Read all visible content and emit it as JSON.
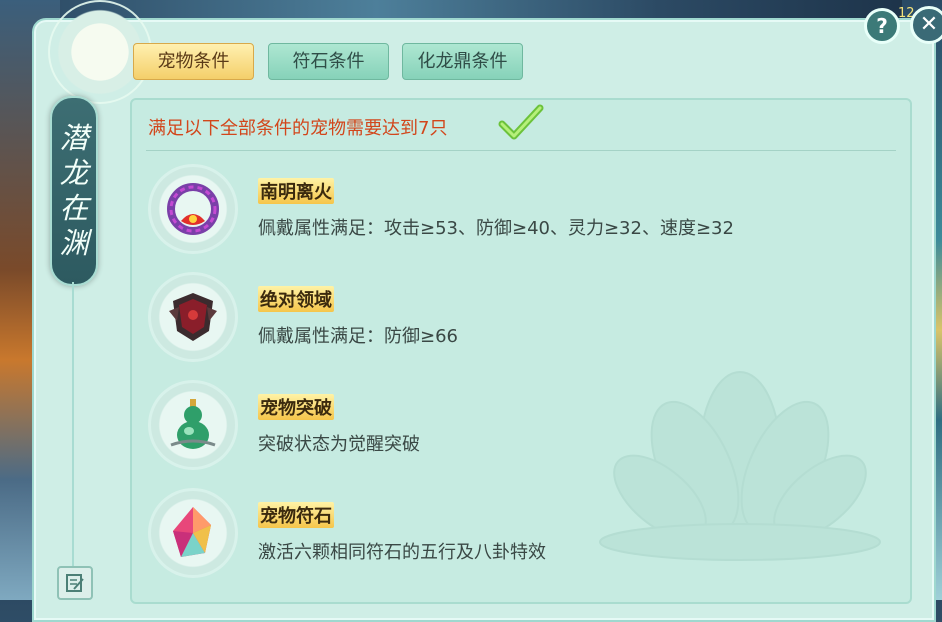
{
  "side_title": [
    "潜",
    "龙",
    "在",
    "渊"
  ],
  "tabs": [
    {
      "label": "宠物条件",
      "active": true
    },
    {
      "label": "符石条件",
      "active": false
    },
    {
      "label": "化龙鼎条件",
      "active": false
    }
  ],
  "requirement": "满足以下全部条件的宠物需要达到7只",
  "conditions": [
    {
      "icon": "red-dragon-collar-icon",
      "title": "南明离火",
      "desc": "佩戴属性满足：攻击≥53、防御≥40、灵力≥32、速度≥32"
    },
    {
      "icon": "dark-armor-icon",
      "title": "绝对领域",
      "desc": "佩戴属性满足：防御≥66"
    },
    {
      "icon": "jade-gourd-icon",
      "title": "宠物突破",
      "desc": "突破状态为觉醒突破"
    },
    {
      "icon": "rune-crystal-icon",
      "title": "宠物符石",
      "desc": "激活六颗相同符石的五行及八卦特效"
    }
  ],
  "buttons": {
    "help": "?",
    "close": "✕"
  },
  "corner_fragment": "12",
  "colors": {
    "panel": "#cfeee6",
    "tab_active": "#f4cf6a",
    "tab": "#86d2b9",
    "requirement_text": "#d2461b",
    "title_bg": "#f5c54a"
  }
}
